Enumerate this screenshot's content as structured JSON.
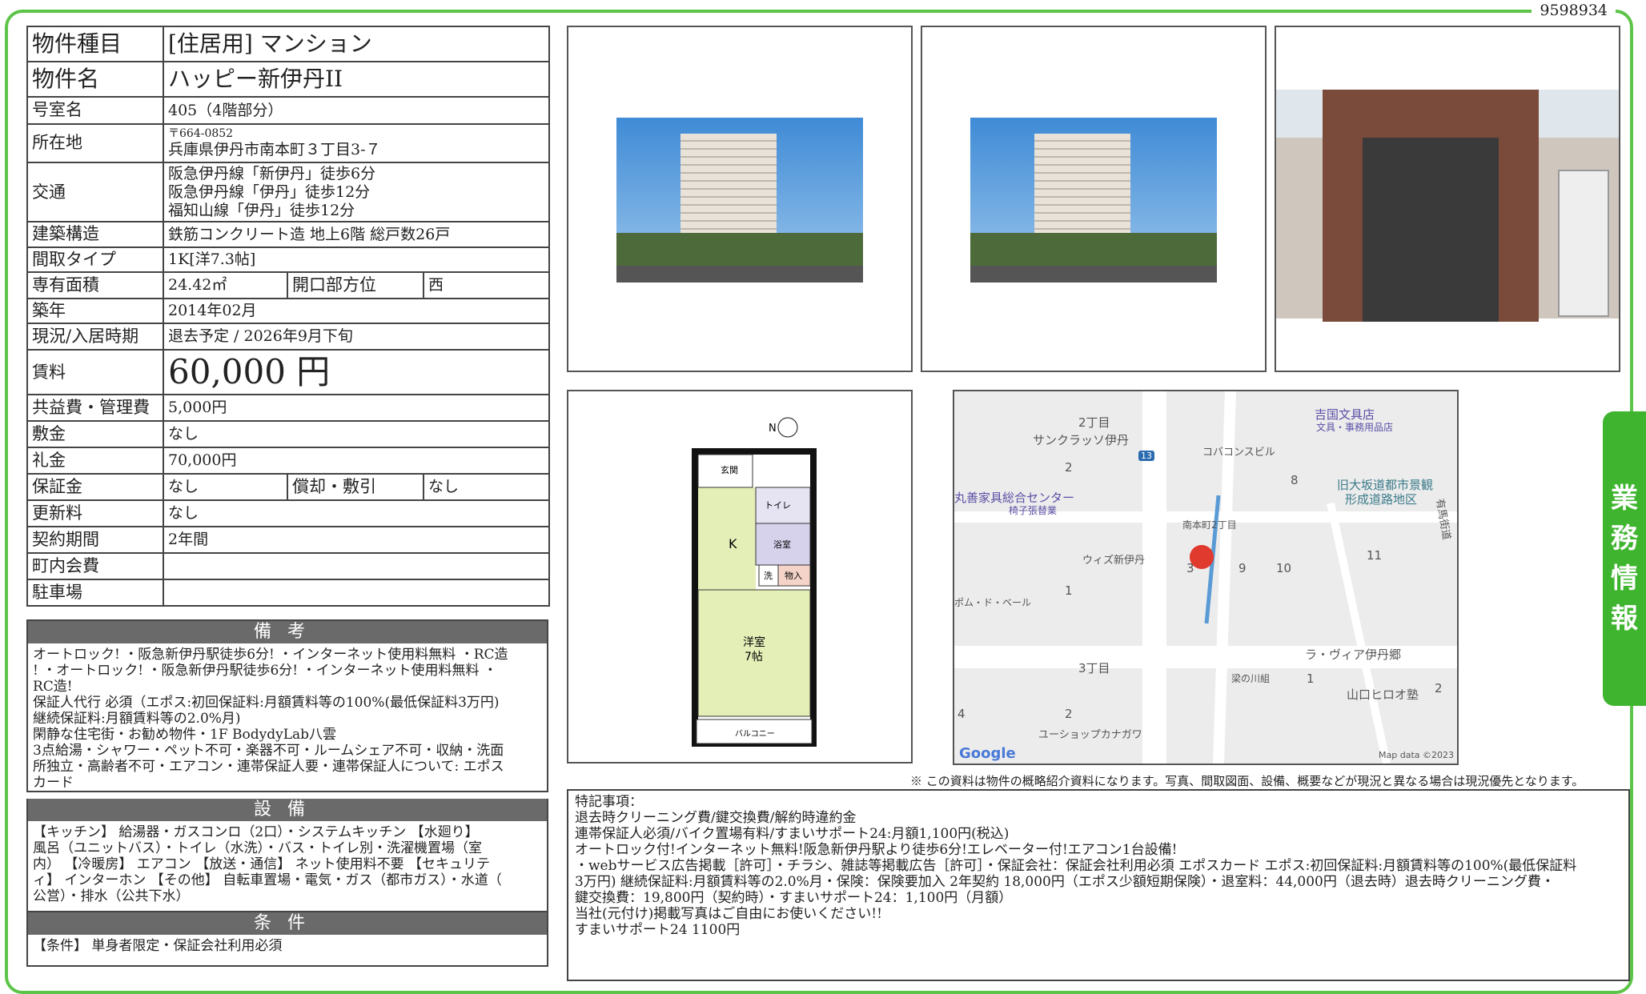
{
  "doc_id": "9598934",
  "side_tab": [
    "業",
    "務",
    "情",
    "報"
  ],
  "spec": {
    "type_label": "物件種目",
    "type_value": "[住居用]  マンション",
    "name_label": "物件名",
    "name_value": "ハッピー新伊丹II",
    "room_label": "号室名",
    "room_value": "405（4階部分）",
    "address_label": "所在地",
    "postal": "〒664-0852",
    "address": "兵庫県伊丹市南本町３丁目3-７",
    "access_label": "交通",
    "access": [
      "阪急伊丹線「新伊丹」徒歩6分",
      "阪急伊丹線「伊丹」徒歩12分",
      "福知山線「伊丹」徒歩12分"
    ],
    "structure_label": "建築構造",
    "structure_value": "鉄筋コンクリート造 地上6階 総戸数26戸",
    "layout_label": "間取タイプ",
    "layout_value": "1K[洋7.3帖]",
    "area_label": "専有面積",
    "area_value": "24.42㎡",
    "facing_label": "開口部方位",
    "facing_value": "西",
    "built_label": "築年",
    "built_value": "2014年02月",
    "status_label": "現況/入居時期",
    "status_value": "退去予定 / 2026年9月下旬",
    "rent_label": "賃料",
    "rent_value": "60,000 円",
    "fee_label": "共益費・管理費",
    "fee_value": "5,000円",
    "deposit_label": "敷金",
    "deposit_value": "なし",
    "keymoney_label": "礼金",
    "keymoney_value": "70,000円",
    "guarantee_label": "保証金",
    "guarantee_value": "なし",
    "amort_label": "償却・敷引",
    "amort_value": "なし",
    "renewal_label": "更新料",
    "renewal_value": "なし",
    "term_label": "契約期間",
    "term_value": "2年間",
    "town_fee_label": "町内会費",
    "town_fee_value": "",
    "parking_label": "駐車場",
    "parking_value": ""
  },
  "biko": {
    "header": "備考",
    "lines": [
      "オートロック! ・阪急新伊丹駅徒歩6分! ・インターネット使用料無料 ・RC造",
      "! ・オートロック! ・阪急新伊丹駅徒歩6分! ・インターネット使用料無料 ・",
      "RC造!",
      "保証人代行 必須（エポス:初回保証料:月額賃料等の100%(最低保証料3万円)",
      "   継続保証料:月額賃料等の2.0%月)",
      "閑静な住宅街・お勧め物件・1F BodydyLab八雲",
      "3点給湯・シャワー・ペット不可・楽器不可・ルームシェア不可・収納・洗面",
      "所独立・高齢者不可・エアコン・連帯保証人要・連帯保証人について: エポス",
      "カード"
    ]
  },
  "setsubi": {
    "header": "設備",
    "lines": [
      "【キッチン】 給湯器・ガスコンロ（2口）・システムキッチン 【水廻り】",
      "風呂（ユニットバス）・トイレ（水洗）・バス・トイレ別・洗濯機置場（室",
      "内） 【冷暖房】 エアコン 【放送・通信】 ネット使用料不要 【セキュリテ",
      "ィ】 インターホン 【その他】 自転車置場・電気・ガス（都市ガス）・水道（",
      "公営）・排水（公共下水）"
    ]
  },
  "joken": {
    "header": "条件",
    "lines": [
      "【条件】 単身者限定・保証会社利用必須"
    ]
  },
  "floorplan": {
    "entrance": "玄関",
    "toilet": "トイレ",
    "bath": "浴室",
    "closet": "物入",
    "kitchen": "K",
    "wash": "洗",
    "room": "洋室",
    "room_size": "7帖",
    "balcony": "バルコニー",
    "north": "N"
  },
  "map": {
    "labels": [
      "2丁目",
      "サンクラッソ伊丹",
      "コバコンスビル",
      "吉国文具店",
      "文具・事務用品店",
      "旧大坂道都市景観",
      "形成道路地区",
      "丸善家具総合センター",
      "椅子張替業",
      "南本町2丁目",
      "ウィズ新伊丹",
      "ポム・ド・ベール",
      "ラ・ヴィア伊丹郷",
      "3丁目",
      "梁の川組",
      "山口ヒロオ塾",
      "ユーショップカナガワ",
      "有馬街道"
    ],
    "numbers": [
      "2",
      "8",
      "1",
      "3",
      "9",
      "10",
      "11",
      "1",
      "2",
      "4",
      "2"
    ],
    "route": "13",
    "google": "Google",
    "attribution": "Map data ©2023"
  },
  "note": "※ この資料は物件の概略紹介資料になります。写真、間取図面、設備、概要などが現況と異なる場合は現況優先となります。",
  "remarks": {
    "lines": [
      "特記事項：",
      "退去時クリーニング費/鍵交換費/解約時違約金",
      "連帯保証人必須/バイク置場有料/すまいサポート24:月額1,100円(税込)",
      "オートロック付!インターネット無料!阪急新伊丹駅より徒歩6分!エレベーター付!エアコン1台設備!",
      "・webサービス広告掲載［許可］・チラシ、雑誌等掲載広告［許可］・保証会社：保証会社利用必須 エポスカード エポス:初回保証料:月額賃料等の100%(最低保証料",
      "3万円) 継続保証料:月額賃料等の2.0%月・保険：保険要加入 2年契約 18,000円（エポス少額短期保険）・退室料：44,000円（退去時）退去時クリーニング費・",
      "鍵交換費：19,800円（契約時）・すまいサポート24：1,100円（月額）",
      "当社(元付け)掲載写真はご自由にお使いください!!",
      "すまいサポート24 1100円"
    ]
  },
  "colors": {
    "accent_green": "#5cc448",
    "header_gray": "#6a6a6a"
  }
}
